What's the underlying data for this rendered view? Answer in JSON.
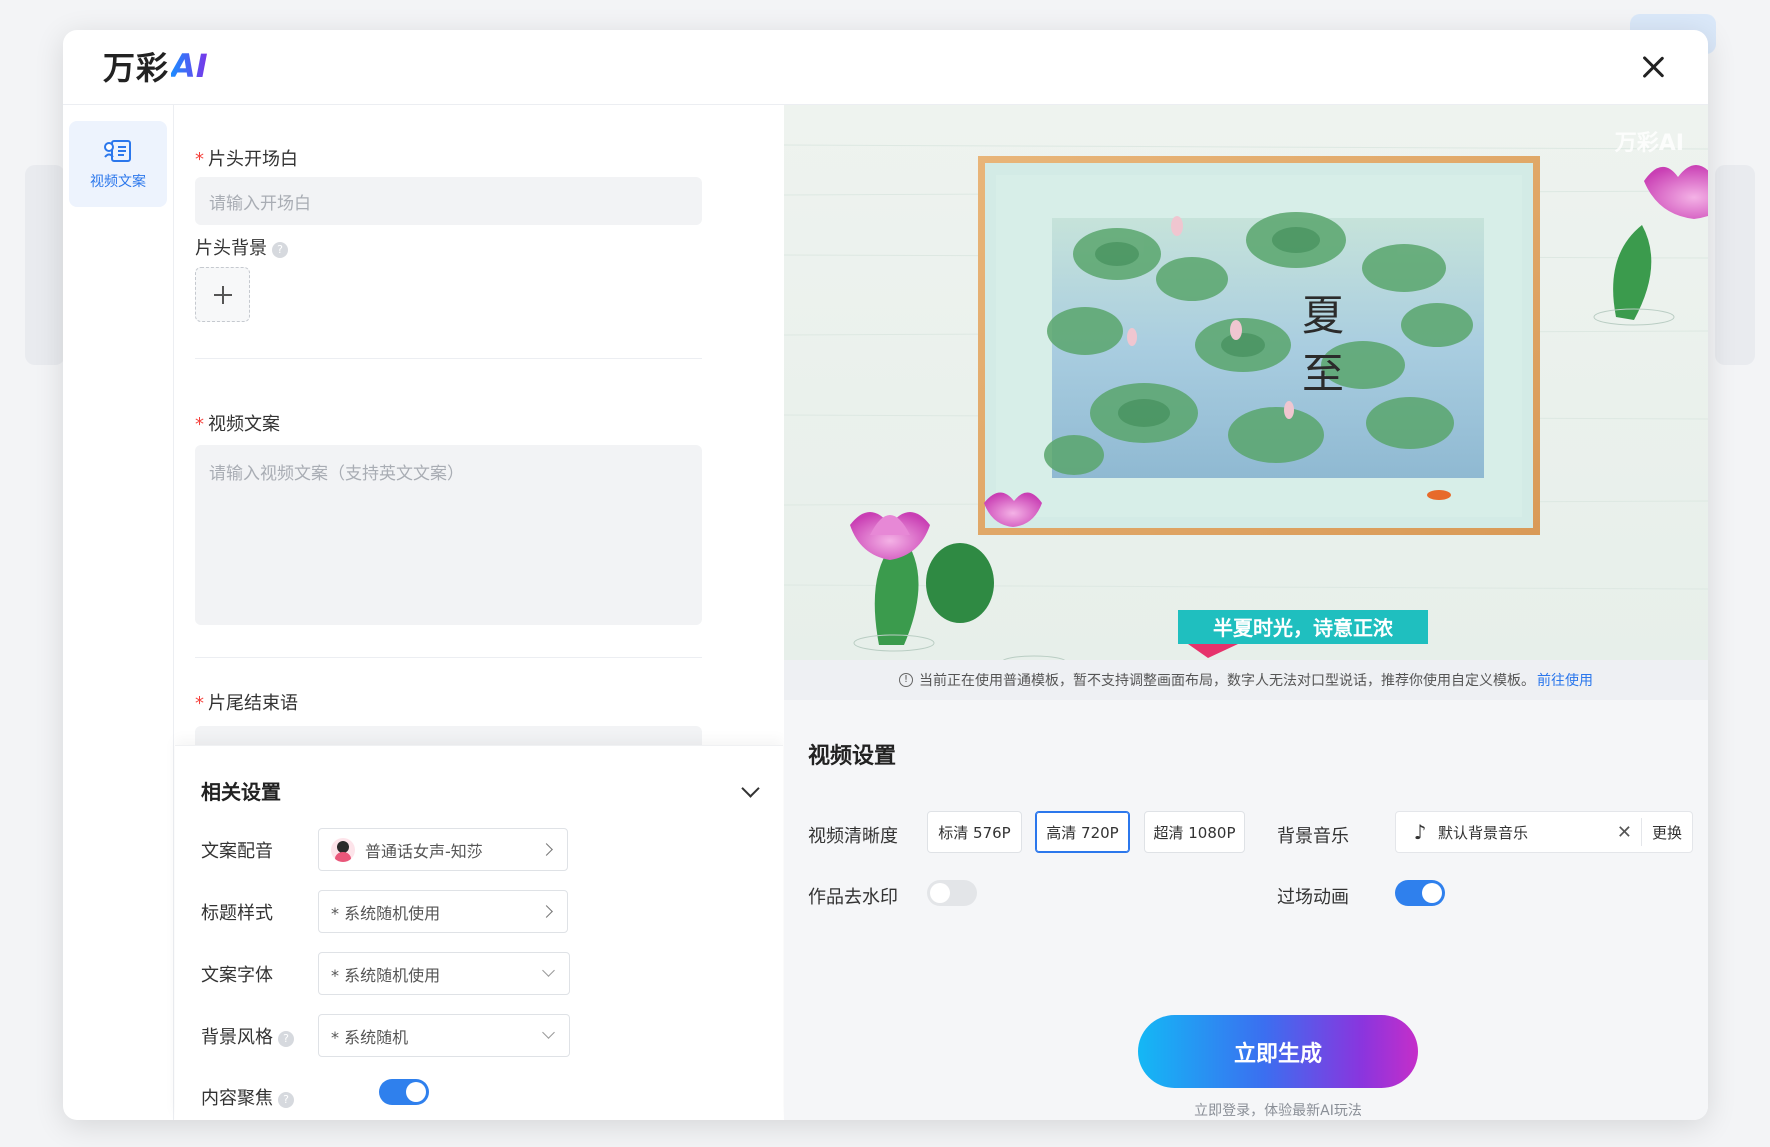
{
  "header": {
    "logo_text": "万彩",
    "logo_ai": "AI"
  },
  "side_nav": {
    "items": [
      {
        "label": "视频文案",
        "icon": "script-edit-icon",
        "active": true
      }
    ]
  },
  "form": {
    "intro": {
      "label": "片头开场白",
      "required": true,
      "placeholder": "请输入开场白"
    },
    "intro_background": {
      "label": "片头背景"
    },
    "script": {
      "label": "视频文案",
      "required": true,
      "placeholder": "请输入视频文案（支持英文文案）"
    },
    "outro": {
      "label": "片尾结束语",
      "required": true
    }
  },
  "related_settings": {
    "title": "相关设置",
    "voice": {
      "label": "文案配音",
      "value": "普通话女声-知莎"
    },
    "title_style": {
      "label": "标题样式",
      "value": "* 系统随机使用"
    },
    "font": {
      "label": "文案字体",
      "value": "* 系统随机使用"
    },
    "bg_style": {
      "label": "背景风格",
      "value": "* 系统随机"
    },
    "focus": {
      "label": "内容聚焦",
      "on": true
    }
  },
  "preview": {
    "watermark": "万彩AI",
    "title_chars": [
      "夏",
      "至"
    ],
    "caption": "半夏时光，诗意正浓"
  },
  "notice": {
    "text": "当前正在使用普通模板，暂不支持调整画面布局，数字人无法对口型说话，推荐你使用自定义模板。",
    "link": "前往使用"
  },
  "video_settings": {
    "title": "视频设置",
    "quality_label": "视频清晰度",
    "quality_options": [
      "标清 576P",
      "高清 720P",
      "超清 1080P"
    ],
    "quality_selected": "高清 720P",
    "music_label": "背景音乐",
    "music_value": "默认背景音乐",
    "music_change": "更换",
    "watermark_label": "作品去水印",
    "watermark_on": false,
    "transition_label": "过场动画",
    "transition_on": true
  },
  "generate": {
    "button_label": "立即生成",
    "hint": "立即登录，体验最新AI玩法"
  },
  "colors": {
    "accent": "#2b77ec",
    "required": "#f5413c"
  }
}
